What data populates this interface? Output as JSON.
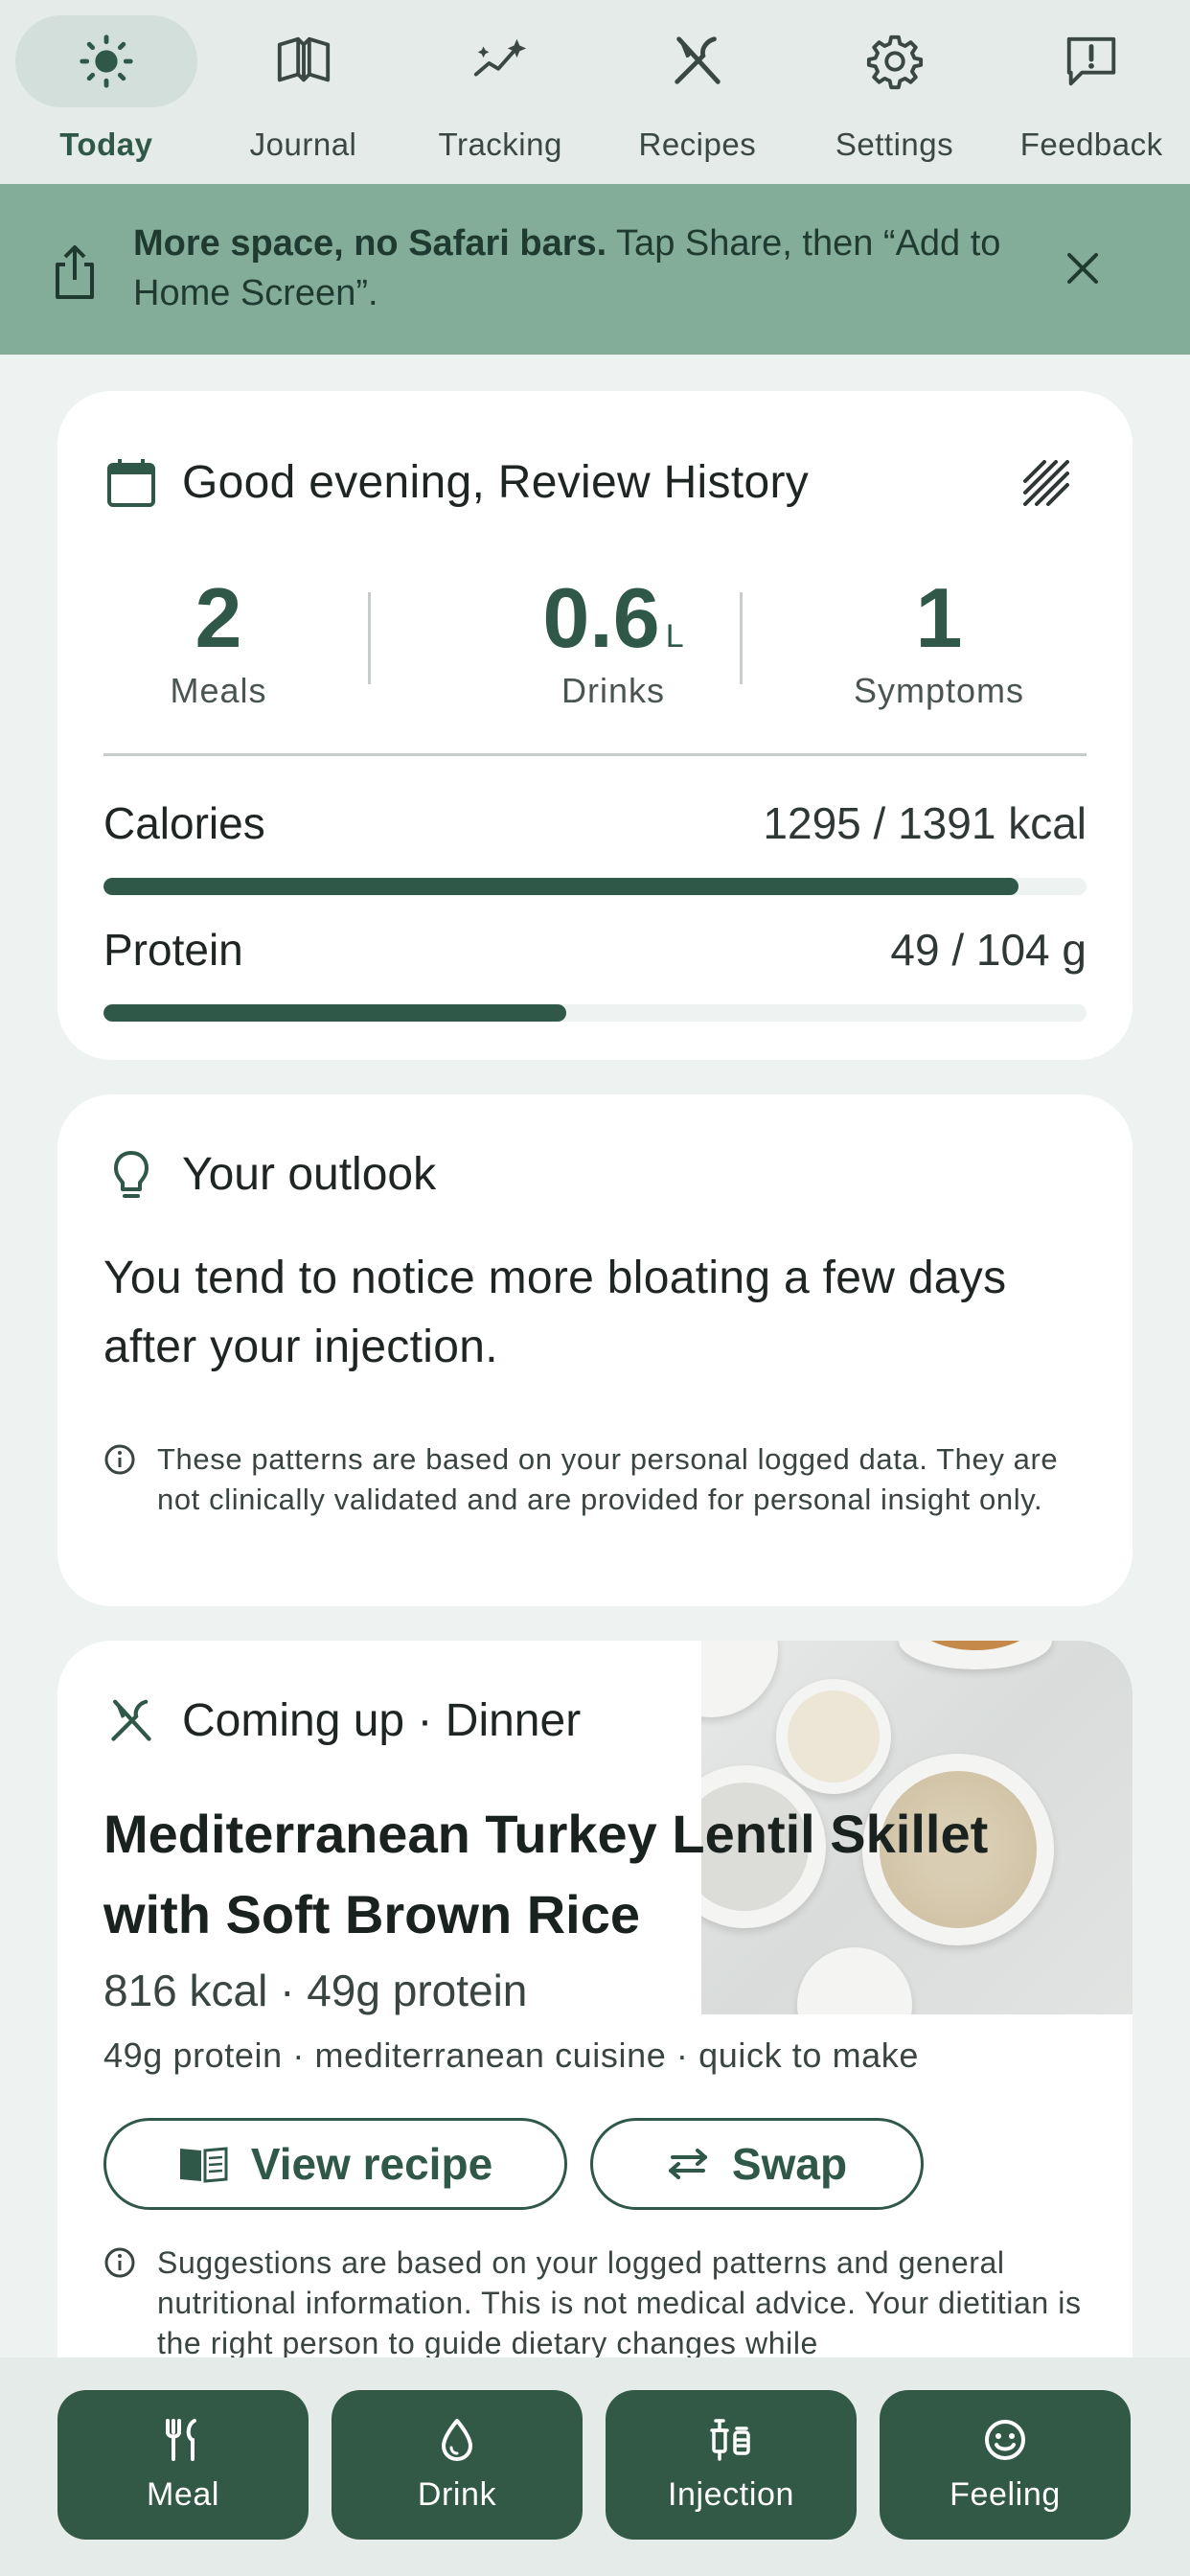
{
  "nav": {
    "items": [
      {
        "label": "Today",
        "icon": "sun-icon",
        "active": true
      },
      {
        "label": "Journal",
        "icon": "book-icon",
        "active": false
      },
      {
        "label": "Tracking",
        "icon": "sparkle-chart-icon",
        "active": false
      },
      {
        "label": "Recipes",
        "icon": "fork-knife-icon",
        "active": false
      },
      {
        "label": "Settings",
        "icon": "gear-icon",
        "active": false
      },
      {
        "label": "Feedback",
        "icon": "feedback-icon",
        "active": false
      }
    ]
  },
  "banner": {
    "bold": "More space, no Safari bars.",
    "text": " Tap Share, then “Add to Home Screen”."
  },
  "summary": {
    "greeting": "Good evening, Review History",
    "stats": [
      {
        "value": "2",
        "unit": "",
        "label": "Meals"
      },
      {
        "value": "0.6",
        "unit": "L",
        "label": "Drinks"
      },
      {
        "value": "1",
        "unit": "",
        "label": "Symptoms"
      }
    ],
    "calories": {
      "label": "Calories",
      "value": "1295 / 1391 kcal",
      "fraction": 0.931
    },
    "protein": {
      "label": "Protein",
      "value": "49 / 104 g",
      "fraction": 0.471
    }
  },
  "outlook": {
    "title": "Your outlook",
    "body": "You tend to notice more bloating a few days after your injection.",
    "disclaimer": "These patterns are based on your personal logged data. They are not clinically validated and are provided for personal insight only."
  },
  "meal": {
    "heading": "Coming up · Dinner",
    "title": "Mediterranean Turkey Lentil Skillet with Soft Brown Rice",
    "kcal": "816 kcal · 49g protein",
    "tags": "49g protein · mediterranean cuisine · quick to make",
    "view_label": "View recipe",
    "swap_label": "Swap",
    "disclaimer": "Suggestions are based on your logged patterns and general nutritional information. This is not medical advice. Your dietitian is the right person to guide dietary changes while"
  },
  "actions": [
    {
      "label": "Meal",
      "icon": "fork-knife-icon"
    },
    {
      "label": "Drink",
      "icon": "droplet-icon"
    },
    {
      "label": "Injection",
      "icon": "syringe-icon"
    },
    {
      "label": "Feeling",
      "icon": "smiley-icon"
    }
  ],
  "colors": {
    "accent": "#2f5848",
    "banner": "#84ad99",
    "background": "#eef3f2"
  }
}
